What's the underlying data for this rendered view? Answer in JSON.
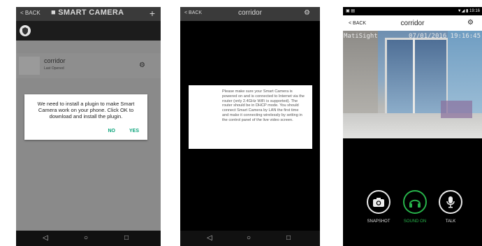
{
  "screen1": {
    "back": "< BACK",
    "title": "■ SMART CAMERA",
    "add": "+",
    "camera": {
      "name": "corridor",
      "status": "Last Opened"
    },
    "dialog": {
      "message": "We need to install a plugin to make Smart Camera work on your phone. Click OK to download and install the plugin.",
      "no": "NO",
      "yes": "YES"
    },
    "nav": {
      "back": "◁",
      "home": "○",
      "recent": "□"
    }
  },
  "screen2": {
    "back": "< BACK",
    "title": "corridor",
    "dialog": {
      "message": "Please make sure your Smart Camera is powered on and is connected to Internet via the router (only 2.4GHz WiFi is supported). The router should be in DHCP mode. You should connect Smart Camera by LAN the first time and make it connecting wirelessly by setting in the control panel of the live video screen."
    },
    "nav": {
      "back": "◁",
      "home": "○",
      "recent": "□"
    }
  },
  "screen3": {
    "status_right": "▼◢ ▮ 19:16",
    "back": "< BACK",
    "title": "corridor",
    "video": {
      "brand": "MatiSight",
      "timestamp": "07/01/2016 19:16:45"
    },
    "controls": {
      "snapshot": "SNAPSHOT",
      "sound": "SOUND ON",
      "talk": "TALK"
    },
    "colors": {
      "sound_active": "#27b24a"
    }
  }
}
